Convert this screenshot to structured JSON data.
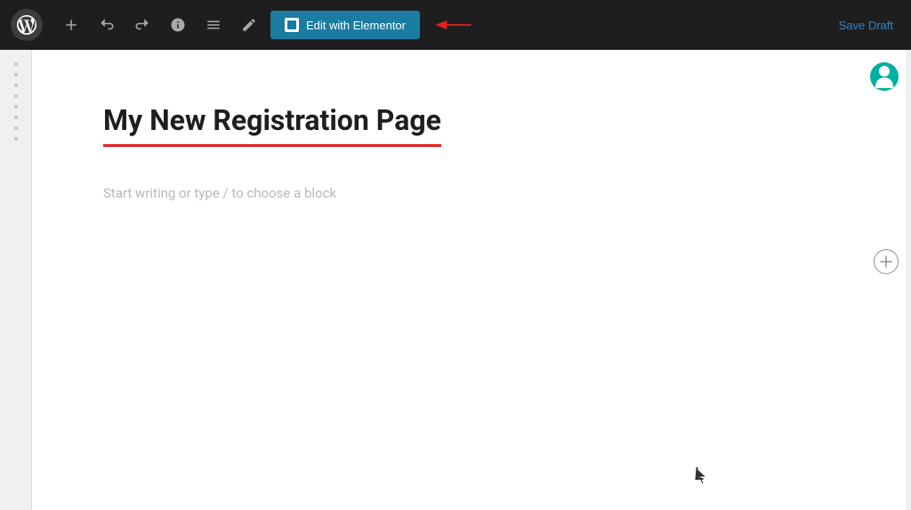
{
  "toolbar": {
    "wp_logo_label": "WordPress",
    "add_icon": "+",
    "undo_icon": "↺",
    "redo_icon": "↻",
    "info_icon": "ℹ",
    "list_icon": "≡",
    "edit_icon": "✏",
    "edit_elementor_label": "Edit with Elementor",
    "save_draft_label": "Save Draft"
  },
  "page": {
    "title": "My New Registration Page",
    "block_placeholder": "Start writing or type / to choose a block"
  },
  "sidebar": {
    "dots": [
      "",
      "",
      "",
      "",
      "",
      "",
      "",
      ""
    ]
  }
}
